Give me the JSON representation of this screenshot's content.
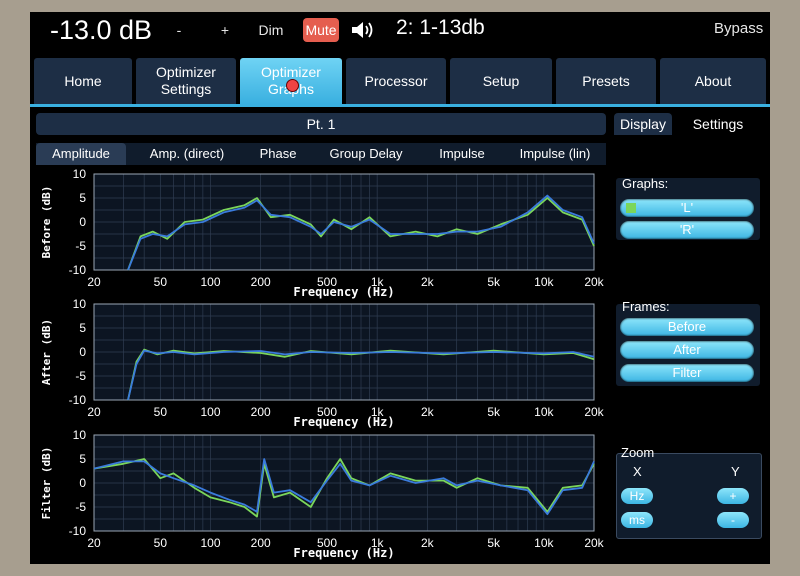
{
  "header": {
    "volume": "-13.0 dB",
    "vol_down": "-",
    "vol_up": "+",
    "dim": "Dim",
    "mute": "Mute",
    "preset": "2: 1-13db",
    "bypass": "Bypass"
  },
  "nav": {
    "tabs": [
      {
        "label": "Home"
      },
      {
        "label": "Optimizer Settings"
      },
      {
        "label": "Optimizer Graphs"
      },
      {
        "label": "Processor"
      },
      {
        "label": "Setup"
      },
      {
        "label": "Presets"
      },
      {
        "label": "About"
      }
    ],
    "active": "Optimizer Graphs"
  },
  "pane": {
    "title": "Pt. 1",
    "graph_tabs": [
      "Amplitude",
      "Amp. (direct)",
      "Phase",
      "Group Delay",
      "Impulse",
      "Impulse (lin)"
    ],
    "active_tab": "Amplitude"
  },
  "right": {
    "tabs": [
      "Display",
      "Settings"
    ],
    "active_tab": "Display",
    "graphs_label": "Graphs:",
    "graphs": [
      {
        "label": "'L'",
        "color": "#7bd65b"
      },
      {
        "label": "'R'",
        "color": "#3a7bdc"
      }
    ],
    "frames_label": "Frames:",
    "frames": [
      "Before",
      "After",
      "Filter"
    ],
    "zoom_label": "Zoom",
    "zoom_x_label": "X",
    "zoom_y_label": "Y",
    "zoom_x_buttons": [
      "Hz",
      "ms"
    ],
    "zoom_y_buttons": [
      "+",
      "-"
    ]
  },
  "colors": {
    "accent": "#3ab0e0",
    "left_channel": "#7bd65b",
    "right_channel": "#3a7bdc"
  },
  "chart_data": [
    {
      "type": "line",
      "ylabel": "Before (dB)",
      "xlabel": "Frequency (Hz)",
      "x_scale": "log",
      "xlim": [
        20,
        20000
      ],
      "ylim": [
        -10,
        10
      ],
      "x_ticks": [
        20,
        50,
        100,
        200,
        500,
        1000,
        2000,
        5000,
        10000,
        20000
      ],
      "x_tick_labels": [
        "20",
        "50",
        "100",
        "200",
        "500",
        "1k",
        "2k",
        "5k",
        "10k",
        "20k"
      ],
      "y_ticks": [
        10,
        5,
        0,
        -5,
        -10
      ],
      "grid": true,
      "series": [
        {
          "name": "'L'",
          "points": [
            [
              32,
              -10
            ],
            [
              38,
              -3
            ],
            [
              45,
              -2
            ],
            [
              55,
              -3.5
            ],
            [
              70,
              0
            ],
            [
              90,
              0.5
            ],
            [
              120,
              2.5
            ],
            [
              160,
              3.5
            ],
            [
              190,
              5
            ],
            [
              230,
              1
            ],
            [
              300,
              1.5
            ],
            [
              400,
              -0.5
            ],
            [
              460,
              -3
            ],
            [
              550,
              0.5
            ],
            [
              700,
              -1.5
            ],
            [
              900,
              1
            ],
            [
              1200,
              -3
            ],
            [
              1700,
              -2
            ],
            [
              2300,
              -3
            ],
            [
              3000,
              -1.5
            ],
            [
              4000,
              -2.5
            ],
            [
              5500,
              -0.5
            ],
            [
              8000,
              1.5
            ],
            [
              10500,
              5
            ],
            [
              13000,
              2
            ],
            [
              17000,
              0.5
            ],
            [
              20000,
              -5
            ]
          ]
        },
        {
          "name": "'R'",
          "points": [
            [
              32,
              -10
            ],
            [
              38,
              -3.5
            ],
            [
              45,
              -2.5
            ],
            [
              55,
              -3
            ],
            [
              70,
              -0.5
            ],
            [
              90,
              0
            ],
            [
              120,
              2
            ],
            [
              160,
              3
            ],
            [
              190,
              4.5
            ],
            [
              230,
              1.5
            ],
            [
              300,
              1
            ],
            [
              400,
              -1
            ],
            [
              460,
              -2.5
            ],
            [
              550,
              0
            ],
            [
              700,
              -1
            ],
            [
              900,
              0.5
            ],
            [
              1200,
              -2.5
            ],
            [
              1700,
              -2.5
            ],
            [
              2300,
              -2.5
            ],
            [
              3000,
              -2
            ],
            [
              4000,
              -2
            ],
            [
              5500,
              -1
            ],
            [
              8000,
              2
            ],
            [
              10500,
              5.5
            ],
            [
              13000,
              2.5
            ],
            [
              17000,
              1
            ],
            [
              20000,
              -4.5
            ]
          ]
        }
      ]
    },
    {
      "type": "line",
      "ylabel": "After (dB)",
      "xlabel": "Frequency (Hz)",
      "x_scale": "log",
      "xlim": [
        20,
        20000
      ],
      "ylim": [
        -10,
        10
      ],
      "x_ticks": [
        20,
        50,
        100,
        200,
        500,
        1000,
        2000,
        5000,
        10000,
        20000
      ],
      "x_tick_labels": [
        "20",
        "50",
        "100",
        "200",
        "500",
        "1k",
        "2k",
        "5k",
        "10k",
        "20k"
      ],
      "y_ticks": [
        10,
        5,
        0,
        -5,
        -10
      ],
      "grid": true,
      "series": [
        {
          "name": "'L'",
          "points": [
            [
              32,
              -10
            ],
            [
              36,
              -2
            ],
            [
              40,
              0.5
            ],
            [
              48,
              -0.5
            ],
            [
              60,
              0.3
            ],
            [
              80,
              -0.3
            ],
            [
              120,
              0.2
            ],
            [
              200,
              -0.2
            ],
            [
              280,
              -1
            ],
            [
              400,
              0.2
            ],
            [
              700,
              -0.5
            ],
            [
              1200,
              0.3
            ],
            [
              2500,
              -0.5
            ],
            [
              5000,
              0.3
            ],
            [
              10000,
              -0.5
            ],
            [
              15000,
              -0.2
            ],
            [
              20000,
              -1.5
            ]
          ]
        },
        {
          "name": "'R'",
          "points": [
            [
              32,
              -10
            ],
            [
              36,
              -2.5
            ],
            [
              40,
              0.3
            ],
            [
              48,
              -0.3
            ],
            [
              60,
              0
            ],
            [
              80,
              -0.5
            ],
            [
              120,
              0
            ],
            [
              200,
              0.2
            ],
            [
              280,
              -0.5
            ],
            [
              400,
              0
            ],
            [
              700,
              -0.2
            ],
            [
              1200,
              0
            ],
            [
              2500,
              -0.3
            ],
            [
              5000,
              0
            ],
            [
              10000,
              -0.3
            ],
            [
              15000,
              0
            ],
            [
              20000,
              -1
            ]
          ]
        }
      ]
    },
    {
      "type": "line",
      "ylabel": "Filter (dB)",
      "xlabel": "Frequency (Hz)",
      "x_scale": "log",
      "xlim": [
        20,
        20000
      ],
      "ylim": [
        -10,
        10
      ],
      "x_ticks": [
        20,
        50,
        100,
        200,
        500,
        1000,
        2000,
        5000,
        10000,
        20000
      ],
      "x_tick_labels": [
        "20",
        "50",
        "100",
        "200",
        "500",
        "1k",
        "2k",
        "5k",
        "10k",
        "20k"
      ],
      "y_ticks": [
        10,
        5,
        0,
        -5,
        -10
      ],
      "grid": true,
      "series": [
        {
          "name": "'L'",
          "points": [
            [
              20,
              3
            ],
            [
              30,
              4
            ],
            [
              40,
              5
            ],
            [
              50,
              1
            ],
            [
              60,
              2
            ],
            [
              80,
              -1
            ],
            [
              100,
              -3
            ],
            [
              130,
              -4
            ],
            [
              160,
              -5
            ],
            [
              190,
              -7
            ],
            [
              210,
              4
            ],
            [
              240,
              -3
            ],
            [
              300,
              -2
            ],
            [
              400,
              -5
            ],
            [
              500,
              1
            ],
            [
              600,
              5
            ],
            [
              700,
              1
            ],
            [
              900,
              -0.5
            ],
            [
              1200,
              2
            ],
            [
              1700,
              0.5
            ],
            [
              2500,
              0.5
            ],
            [
              3000,
              -1
            ],
            [
              4000,
              1
            ],
            [
              5500,
              -0.5
            ],
            [
              8000,
              -1
            ],
            [
              10500,
              -6
            ],
            [
              13000,
              -1
            ],
            [
              17000,
              -0.5
            ],
            [
              20000,
              4
            ]
          ]
        },
        {
          "name": "'R'",
          "points": [
            [
              20,
              3
            ],
            [
              30,
              4.5
            ],
            [
              40,
              4.5
            ],
            [
              50,
              2
            ],
            [
              60,
              1
            ],
            [
              80,
              -0.5
            ],
            [
              100,
              -2
            ],
            [
              130,
              -3.5
            ],
            [
              160,
              -4.5
            ],
            [
              190,
              -6
            ],
            [
              210,
              5
            ],
            [
              240,
              -2
            ],
            [
              300,
              -1.5
            ],
            [
              400,
              -4
            ],
            [
              500,
              0.5
            ],
            [
              600,
              4
            ],
            [
              700,
              0.5
            ],
            [
              900,
              -0.5
            ],
            [
              1200,
              1.5
            ],
            [
              1700,
              0
            ],
            [
              2500,
              1
            ],
            [
              3000,
              -0.5
            ],
            [
              4000,
              0.5
            ],
            [
              5500,
              -0.5
            ],
            [
              8000,
              -1.5
            ],
            [
              10500,
              -6.5
            ],
            [
              13000,
              -1.5
            ],
            [
              17000,
              -1
            ],
            [
              20000,
              4.5
            ]
          ]
        }
      ]
    }
  ]
}
